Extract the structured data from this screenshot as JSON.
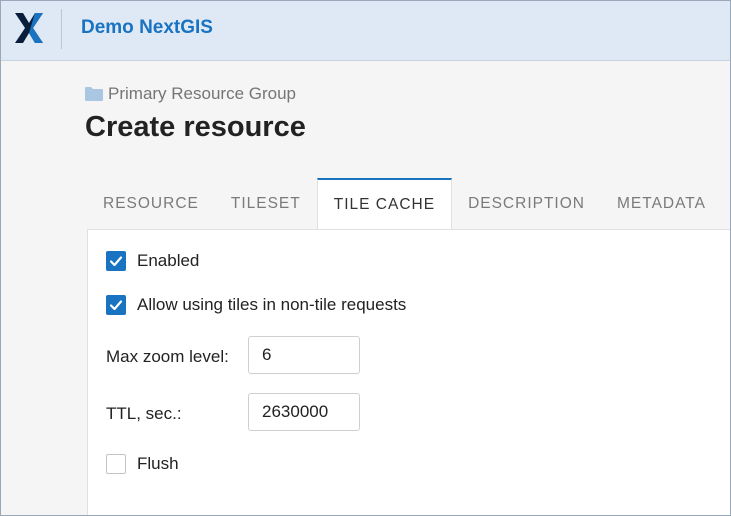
{
  "header": {
    "app_title": "Demo NextGIS",
    "logo_icon": "nextgis-x-logo-icon",
    "colors": {
      "header_bg": "#dfe9f5",
      "accent": "#1a73c0"
    }
  },
  "breadcrumb": {
    "icon": "folder-icon",
    "label": "Primary Resource Group"
  },
  "page": {
    "title": "Create resource"
  },
  "tabs": [
    {
      "label": "RESOURCE",
      "active": false
    },
    {
      "label": "TILESET",
      "active": false
    },
    {
      "label": "TILE CACHE",
      "active": true
    },
    {
      "label": "DESCRIPTION",
      "active": false
    },
    {
      "label": "METADATA",
      "active": false
    }
  ],
  "form": {
    "enabled": {
      "label": "Enabled",
      "checked": true
    },
    "allow_tiles": {
      "label": "Allow using tiles in non-tile requests",
      "checked": true
    },
    "max_zoom": {
      "label": "Max zoom level:",
      "value": "6"
    },
    "ttl": {
      "label": "TTL, sec.:",
      "value": "2630000"
    },
    "flush": {
      "label": "Flush",
      "checked": false
    }
  }
}
